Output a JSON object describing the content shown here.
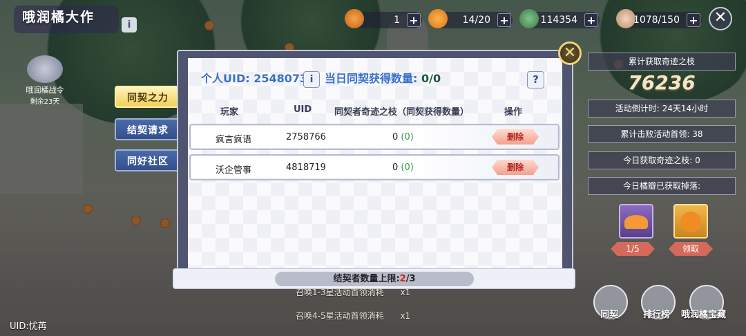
{
  "header": {
    "event_title": "哦润橘大作",
    "resources": [
      {
        "icon": "coin-icon",
        "value": "1"
      },
      {
        "icon": "orange-icon",
        "value": "14/20"
      },
      {
        "icon": "leaf-icon",
        "value": "114354"
      },
      {
        "icon": "drumstick-icon",
        "value": "1078/150"
      }
    ],
    "plus": "+",
    "close": "✕",
    "info": "i"
  },
  "battle_pass": {
    "title": "哦润橘战令",
    "remaining": "剩余23天"
  },
  "tabs": [
    {
      "label": "同契之力",
      "active": true
    },
    {
      "label": "结契请求",
      "active": false
    },
    {
      "label": "同好社区",
      "active": false
    }
  ],
  "modal": {
    "uid_label": "个人UID: 2548073",
    "daily_label": "当日同契获得数量:",
    "daily_value": "0/0",
    "info": "i",
    "help": "?",
    "close": "✕",
    "columns": [
      "玩家",
      "UID",
      "同契者奇迹之枝（同契获得数量）",
      "操作"
    ],
    "rows": [
      {
        "name": "疯言疯语",
        "uid": "2758766",
        "count": "0",
        "gain": "(0)",
        "action": "删除"
      },
      {
        "name": "沃企管事",
        "uid": "4818719",
        "count": "0",
        "gain": "(0)",
        "action": "删除"
      }
    ],
    "limit_prefix": "结契者数量上限:",
    "limit_current": "2",
    "limit_suffix": "/3"
  },
  "right_panel": {
    "total_title": "累计获取奇迹之枝",
    "total_value": "76236",
    "countdown": "活动倒计时: 24天14小时",
    "bosses": "累计击败活动首领: 38",
    "today_branch": "今日获取奇迹之枝: 0",
    "today_drops": "今日橘瓣已获取掉落:",
    "item1_label": "1/5",
    "item2_label": "领取"
  },
  "bottom": {
    "summon1": "召唤1-3星活动首领消耗",
    "summon1_cost": "x1",
    "summon2": "召唤4-5星活动首领消耗",
    "summon2_cost": "x1",
    "uid": "UID:忧苒",
    "buttons": [
      "同契",
      "排行榜",
      "哦润橘宝藏"
    ]
  },
  "colors": {
    "accent_blue": "#3b6fd0",
    "tab_active": "#f2cf5a",
    "tab_normal": "#34508c",
    "delete": "#f2a18e",
    "limit_red": "#d0231b"
  }
}
